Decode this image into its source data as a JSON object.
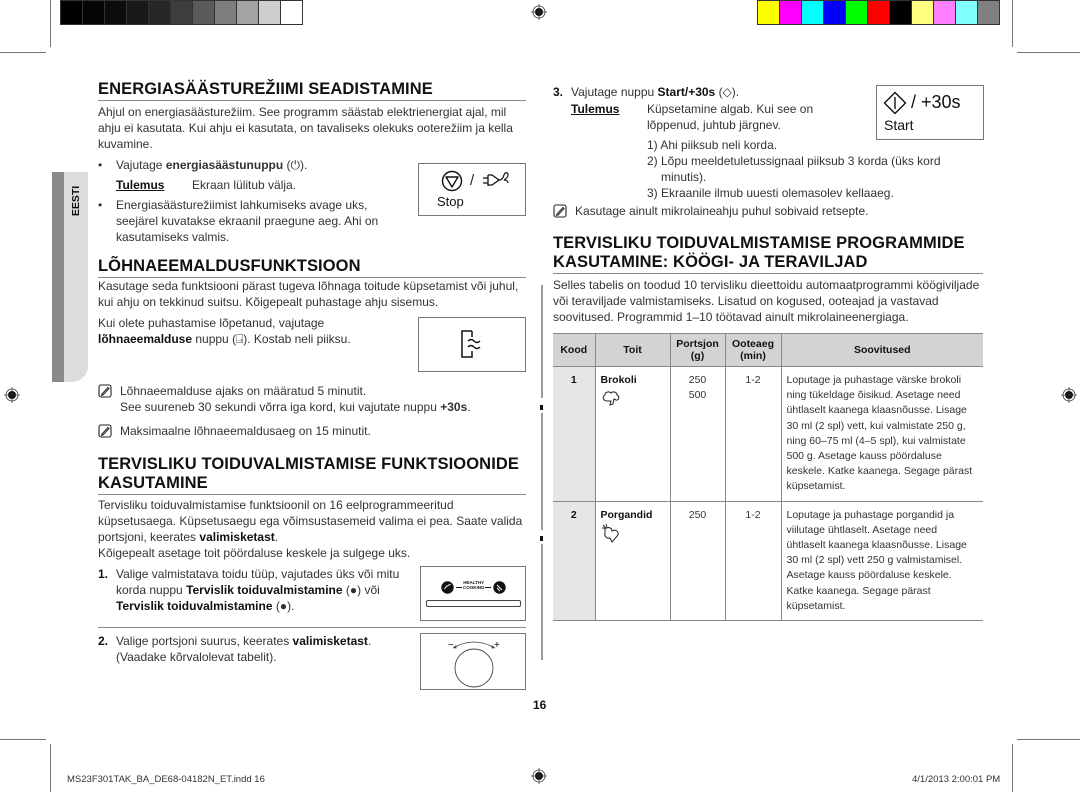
{
  "print_marks": {
    "grayscale_swatches": [
      "#000000",
      "#050505",
      "#0d0d0d",
      "#181818",
      "#272727",
      "#3d3d3d",
      "#5a5a5a",
      "#7d7d7d",
      "#a3a3a3",
      "#cfcfcf",
      "#ffffff"
    ],
    "color_swatches": [
      "#ffff00",
      "#ff00ff",
      "#00ffff",
      "#0000ff",
      "#00ff00",
      "#ff0000",
      "#000000",
      "#ffff80",
      "#ff80ff",
      "#80ffff",
      "#808080"
    ]
  },
  "side_tab": {
    "label": "EESTI"
  },
  "left": {
    "energy": {
      "title": "ENERGIASÄÄSTUREŽIIMI SEADISTAMINE",
      "intro": "Ahjul on energiasäästurežiim. See programm säästab elektrienergiat ajal, mil ahju ei kasutata. Kui ahju ei kasutata, on tavaliseks olekuks ooterežiim ja kella kuvamine.",
      "bullet1_pre": "Vajutage ",
      "bullet1_bold": "energiasäästunuppu",
      "bullet1_post": " (⏻).",
      "result_label": "Tulemus",
      "result_text": "Ekraan lülitub välja.",
      "bullet2": "Energiasäästurežiimist lahkumiseks avage uks, seejärel kuvatakse ekraanil praegune aeg. Ahi on kasutamiseks valmis.",
      "panel": {
        "slash": "/",
        "label": "Stop"
      }
    },
    "odour": {
      "title": "LÕHNAEEMALDUSFUNKTSIOON",
      "intro": "Kasutage seda funktsiooni pärast tugeva lõhnaga toitude küpsetamist või juhul, kui ahju on tekkinud suitsu. Kõigepealt puhastage ahju sisemus.",
      "line1": "Kui olete puhastamise lõpetanud, vajutage",
      "line2_bold": "lõhnaeemalduse",
      "line2_post": " nuppu (⍈). Kostab neli piiksu.",
      "note1_line1": "Lõhnaeemalduse ajaks on määratud 5 minutit.",
      "note1_line2_pre": "See suureneb 30 sekundi võrra iga kord, kui vajutate nuppu ",
      "note1_line2_bold": "+30s",
      "note1_line2_post": ".",
      "note2": "Maksimaalne lõhnaeemaldusaeg on 15 minutit."
    },
    "healthy": {
      "title_line1": "TERVISLIKU TOIDUVALMISTAMISE FUNKTSIOONIDE",
      "title_line2": "KASUTAMINE",
      "intro_pre": "Tervisliku toiduvalmistamise funktsioonil on 16 eelprogrammeeritud küpsetusaega. Küpsetusaegu ega võimsustasemeid valima ei pea. Saate valida portsjoni, keerates ",
      "intro_bold": "valimisketast",
      "intro_post": ".",
      "intro2": "Kõigepealt asetage toit pöördaluse keskele ja sulgege uks.",
      "step1_num": "1.",
      "step1_pre": "Valige valmistatava toidu tüüp, vajutades üks või mitu korda nuppu ",
      "step1_bold1": "Tervislik toiduvalmistamine",
      "step1_mid": " (●) või ",
      "step1_bold2": "Tervislik toiduvalmistamine",
      "step1_post": " (●).",
      "step1_panel_label_1": "HEALTHY",
      "step1_panel_label_2": "COOKING",
      "step2_num": "2.",
      "step2_pre": "Valige portsjoni suurus, keerates ",
      "step2_bold": "valimisketast",
      "step2_post": ".",
      "step2_line2": "(Vaadake kõrvalolevat tabelit).",
      "dial_minus": "−",
      "dial_plus": "+"
    }
  },
  "right": {
    "step3_num": "3.",
    "step3_pre": "Vajutage nuppu ",
    "step3_bold": "Start/+30s",
    "step3_post": " (◇).",
    "result_label": "Tulemus",
    "result_text": "Küpsetamine algab. Kui see on lõppenud, juhtub järgnev.",
    "result_items": [
      "1)  Ahi piiksub neli korda.",
      "2)  Lõpu meeldetuletussignaal piiksub 3 korda (üks kord minutis).",
      "3)  Ekraanile ilmub uuesti olemasolev kellaaeg."
    ],
    "note": "Kasutage ainult mikrolaineahju puhul sobivaid retsepte.",
    "start_panel": {
      "slash_text": "/ +30s",
      "label": "Start"
    },
    "programs": {
      "title_line1": "TERVISLIKU TOIDUVALMISTAMISE PROGRAMMIDE",
      "title_line2": "KASUTAMINE: KÖÖGI- JA TERAVILJAD",
      "intro": "Selles tabelis on toodud 10 tervisliku dieettoidu automaatprogrammi köögiviljade või teraviljade valmistamiseks. Lisatud on kogused, ooteajad ja vastavad soovitused. Programmid 1–10 töötavad ainult mikrolaineenergiaga.",
      "table": {
        "headers": [
          "Kood",
          "Toit",
          "Portsjon (g)",
          "Ooteaeg (min)",
          "Soovitused"
        ],
        "rows": [
          {
            "code": "1",
            "food": "Brokoli",
            "food_icon": "broccoli-icon",
            "portion": [
              "250",
              "500"
            ],
            "wait": "1-2",
            "advice": "Loputage ja puhastage värske brokoli ning tükeldage õisikud. Asetage need ühtlaselt kaanega klaasnõusse. Lisage 30 ml (2 spl) vett, kui valmistate 250 g, ning 60–75 ml (4–5 spl), kui valmistate 500 g. Asetage kauss pöördaluse keskele. Katke kaanega. Segage pärast küpsetamist."
          },
          {
            "code": "2",
            "food": "Porgandid",
            "food_icon": "carrot-icon",
            "portion": [
              "250"
            ],
            "wait": "1-2",
            "advice": "Loputage ja puhastage porgandid ja viilutage ühtlaselt. Asetage need ühtlaselt kaanega klaasnõusse. Lisage 30 ml (2 spl) vett 250 g valmistamisel. Asetage kauss pöördaluse keskele. Katke kaanega. Segage pärast küpsetamist."
          }
        ]
      }
    }
  },
  "page_number": "16",
  "footer": {
    "left": "MS23F301TAK_BA_DE68-04182N_ET.indd   16",
    "right": "4/1/2013   2:00:01 PM"
  }
}
